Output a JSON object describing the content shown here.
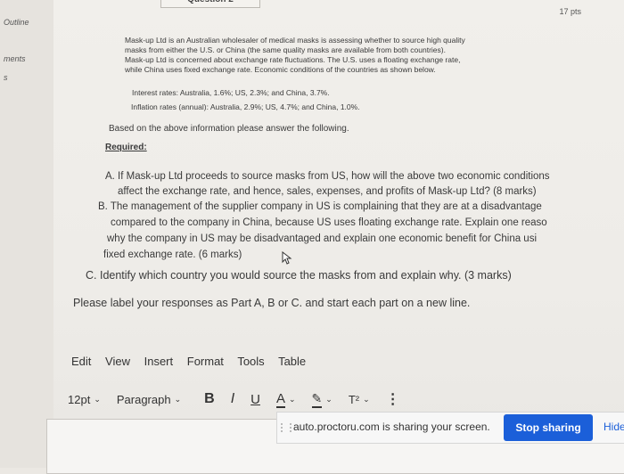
{
  "sidebar": {
    "outline_label": "Outline",
    "ments_label": "ments",
    "s_label": "s"
  },
  "header": {
    "question_label": "Question 2",
    "points": "17 pts"
  },
  "question": {
    "intro_lines": [
      "Mask-up Ltd is an Australian wholesaler of medical masks is assessing whether to source high quality",
      "masks from either the U.S. or China (the same quality masks are available from both countries).",
      "Mask-up Ltd is concerned about exchange rate fluctuations. The U.S. uses a floating exchange rate,",
      "while China uses fixed exchange rate. Economic conditions of the countries as shown below."
    ],
    "interest_rates": "Interest rates: Australia, 1.6%; US, 2.3%; and China, 3.7%.",
    "inflation_rates": "Inflation rates (annual): Australia, 2.9%; US, 4.7%; and China, 1.0%.",
    "instruction": "Based on the above information please answer the following.",
    "required_label": "Required:",
    "part_a_lines": [
      "A. If Mask-up Ltd proceeds to source masks from US, how will the above two economic conditions",
      "affect the exchange rate, and hence, sales, expenses, and profits of Mask-up Ltd? (8 marks)"
    ],
    "part_b_lines": [
      "B. The management of the supplier company in US is complaining that they are at a disadvantage",
      "compared to the company in China, because US uses floating exchange rate. Explain one reaso",
      "why the company in US may be disadvantaged and explain one economic benefit for China usi",
      "fixed exchange rate. (6 marks)"
    ],
    "part_c": "C. Identify which country you would source the masks from and explain why. (3 marks)",
    "label_instruction": "Please label your responses as Part A, B or C. and start each part on a new line."
  },
  "editor": {
    "menu": [
      "Edit",
      "View",
      "Insert",
      "Format",
      "Tools",
      "Table"
    ],
    "font_size": "12pt",
    "block_format": "Paragraph",
    "bold_label": "B",
    "italic_label": "I",
    "underline_label": "U",
    "text_color_label": "A",
    "superscript_label": "T²",
    "more_label": "⋮"
  },
  "share_bar": {
    "message": "auto.proctoru.com is sharing your screen.",
    "stop_label": "Stop sharing",
    "hide_label": "Hide"
  }
}
